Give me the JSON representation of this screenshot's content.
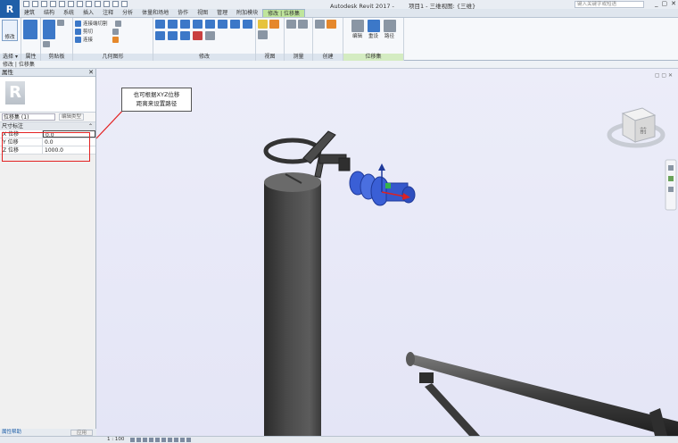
{
  "window": {
    "app_title": "Autodesk Revit 2017 -",
    "document_title": "项目1 - 三维视图: {三维}",
    "search_placeholder": "键入关键字或短语",
    "controls": [
      "_",
      "▢",
      "✕"
    ]
  },
  "app_button_label": "R",
  "ribbon": {
    "tabs": [
      {
        "label": "建筑",
        "active": false
      },
      {
        "label": "结构",
        "active": false
      },
      {
        "label": "系统",
        "active": false
      },
      {
        "label": "插入",
        "active": false
      },
      {
        "label": "注释",
        "active": false
      },
      {
        "label": "分析",
        "active": false
      },
      {
        "label": "体量和场地",
        "active": false
      },
      {
        "label": "协作",
        "active": false
      },
      {
        "label": "视图",
        "active": false
      },
      {
        "label": "管理",
        "active": false
      },
      {
        "label": "附加模块",
        "active": false
      },
      {
        "label": "修改 | 位移集",
        "active": true
      }
    ],
    "panels": {
      "select": {
        "label": "选择 ▾",
        "modify_label": "修改"
      },
      "properties": {
        "label": "属性"
      },
      "clipboard": {
        "label": "剪贴板"
      },
      "geometry": {
        "label": "几何图形",
        "items": [
          "连接端切割",
          "剪切",
          "连接"
        ]
      },
      "modify": {
        "label": "修改"
      },
      "view": {
        "label": "视图"
      },
      "measure": {
        "label": "测量"
      },
      "create": {
        "label": "创建"
      },
      "displacement": {
        "label": "位移集",
        "items": [
          "编辑",
          "重设",
          "路径"
        ]
      }
    }
  },
  "context_bar": "修改 | 位移集",
  "properties": {
    "title": "属性",
    "close": "✕",
    "type_selector": "位移集 (1)",
    "edit_type": "编辑类型",
    "section": "尺寸标注",
    "rows": [
      {
        "label": "X 位移",
        "value": "0.0"
      },
      {
        "label": "Y 位移",
        "value": "0.0"
      },
      {
        "label": "Z 位移",
        "value": "1000.0"
      }
    ],
    "help_link": "属性帮助",
    "apply": "应用"
  },
  "viewport": {
    "callout_line1": "也可根据XYZ位移",
    "callout_line2": "距离来设置路径",
    "viewcube_face": "前"
  },
  "status": {
    "scale": "1 : 100"
  },
  "colors": {
    "accent": "#1f5fa8",
    "context_tab": "#bfe59c",
    "highlight": "#e32222",
    "viewport_bg": "#e8e9f8",
    "part_blue": "#3a5fd6"
  }
}
